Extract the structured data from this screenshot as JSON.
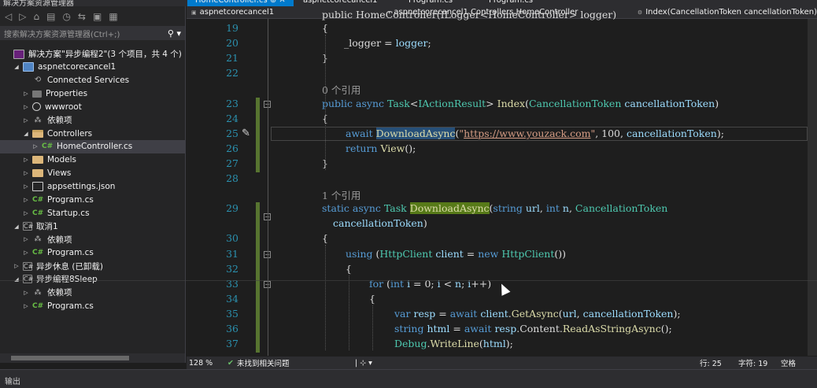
{
  "app": {
    "solution_explorer_title": "解决方案资源管理器",
    "pane_controls": "▾ ♯ ✕"
  },
  "tabs": [
    {
      "label": "HomeController.cs  ⊕  ✕",
      "active": true
    },
    {
      "label": "aspnetcorecancel1"
    },
    {
      "label": "Program.cs"
    },
    {
      "label": "Program.cs"
    }
  ],
  "solution_explorer": {
    "search_placeholder": "搜索解决方案资源管理器(Ctrl+;)",
    "tree": [
      {
        "label": "解决方案\"异步编程2\"(3 个项目，共 4 个)",
        "icon": "solution-icon",
        "indent": 0,
        "toggle": ""
      },
      {
        "label": "aspnetcorecancel1",
        "icon": "project-icon",
        "indent": 1,
        "toggle": "◢"
      },
      {
        "label": "Connected Services",
        "icon": "connected-services-icon",
        "indent": 2,
        "toggle": ""
      },
      {
        "label": "Properties",
        "icon": "properties-icon",
        "indent": 2,
        "toggle": "▷"
      },
      {
        "label": "wwwroot",
        "icon": "globe-icon",
        "indent": 2,
        "toggle": "▷"
      },
      {
        "label": "依赖项",
        "icon": "dependencies-icon",
        "indent": 2,
        "toggle": "▷"
      },
      {
        "label": "Controllers",
        "icon": "folder-open-icon",
        "indent": 2,
        "toggle": "◢"
      },
      {
        "label": "HomeController.cs",
        "icon": "csharp-file-icon",
        "indent": 3,
        "toggle": "▷",
        "selected": true
      },
      {
        "label": "Models",
        "icon": "folder-icon",
        "indent": 2,
        "toggle": "▷"
      },
      {
        "label": "Views",
        "icon": "folder-icon",
        "indent": 2,
        "toggle": "▷"
      },
      {
        "label": "appsettings.json",
        "icon": "json-file-icon",
        "indent": 2,
        "toggle": "▷"
      },
      {
        "label": "Program.cs",
        "icon": "csharp-file-icon",
        "indent": 2,
        "toggle": "▷"
      },
      {
        "label": "Startup.cs",
        "icon": "csharp-file-icon",
        "indent": 2,
        "toggle": "▷"
      },
      {
        "label": "取消1",
        "icon": "csharp-project-icon",
        "indent": 1,
        "toggle": "◢"
      },
      {
        "label": "依赖项",
        "icon": "dependencies-icon",
        "indent": 2,
        "toggle": "▷"
      },
      {
        "label": "Program.cs",
        "icon": "csharp-file-icon",
        "indent": 2,
        "toggle": "▷"
      },
      {
        "label": "异步休息 (已卸载)",
        "icon": "unloaded-project-icon",
        "indent": 1,
        "toggle": "▷"
      },
      {
        "label": "异步编程8Sleep",
        "icon": "csharp-project-icon",
        "indent": 1,
        "toggle": "◢"
      },
      {
        "label": "依赖项",
        "icon": "dependencies-icon",
        "indent": 2,
        "toggle": "▷"
      },
      {
        "label": "Program.cs",
        "icon": "csharp-file-icon",
        "indent": 2,
        "toggle": "▷"
      }
    ]
  },
  "navbar": {
    "project": "aspnetcorecancel1",
    "class": "aspnetcorecancel1.Controllers.HomeController",
    "member": "Index(CancellationToken cancellationToken)"
  },
  "code": {
    "lines": [
      {
        "n": "19",
        "text": "{"
      },
      {
        "n": "20",
        "text": "_logger = logger;"
      },
      {
        "n": "21",
        "text": "}"
      },
      {
        "n": "22",
        "text": ""
      },
      {
        "n": "",
        "text": "0 个引用"
      },
      {
        "n": "23",
        "text": "public async Task<IActionResult> Index(CancellationToken cancellationToken)"
      },
      {
        "n": "24",
        "text": "{"
      },
      {
        "n": "25",
        "text": "await DownloadAsync(\"https://www.youzack.com\", 100, cancellationToken);"
      },
      {
        "n": "26",
        "text": "return View();"
      },
      {
        "n": "27",
        "text": "}"
      },
      {
        "n": "28",
        "text": ""
      },
      {
        "n": "",
        "text": "1 个引用"
      },
      {
        "n": "29",
        "text": "static async Task DownloadAsync(string url, int n, CancellationToken"
      },
      {
        "n": "",
        "text": "cancellationToken)"
      },
      {
        "n": "30",
        "text": "{"
      },
      {
        "n": "31",
        "text": "using (HttpClient client = new HttpClient())"
      },
      {
        "n": "32",
        "text": "{"
      },
      {
        "n": "33",
        "text": "for (int i = 0; i < n; i++)"
      },
      {
        "n": "34",
        "text": "{"
      },
      {
        "n": "35",
        "text": "var resp = await client.GetAsync(url, cancellationToken);"
      },
      {
        "n": "36",
        "text": "string html = await resp.Content.ReadAsStringAsync();"
      },
      {
        "n": "37",
        "text": "Debug.WriteLine(html);"
      }
    ],
    "partial_top": "public HomeController(ILogger<HomeController> logger)"
  },
  "status": {
    "zoom": "128 %",
    "issues": "未找到相关问题",
    "line": "行: 25",
    "column": "字符: 19",
    "mode": "空格"
  },
  "bottom_panel": {
    "title": "输出"
  }
}
